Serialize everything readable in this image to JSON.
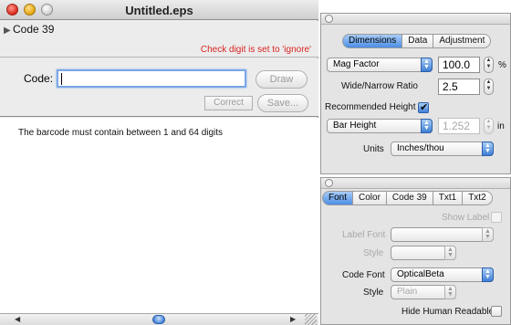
{
  "window": {
    "title": "Untitled.eps",
    "section_title": "Code 39",
    "check_note": "Check digit is set to 'ignore'",
    "code_label": "Code:",
    "code_value": "",
    "draw_label": "Draw",
    "correct_label": "Correct",
    "save_label": "Save...",
    "message": "The barcode must contain between 1 and 64  digits"
  },
  "dimensions_panel": {
    "tabs": [
      {
        "label": "Dimensions",
        "active": true
      },
      {
        "label": "Data",
        "active": false
      },
      {
        "label": "Adjustment",
        "active": false
      }
    ],
    "mag_factor_select": "Mag Factor",
    "mag_factor_value": "100.0",
    "mag_factor_unit": "%",
    "ratio_label": "Wide/Narrow Ratio",
    "ratio_value": "2.5",
    "recommended_height_label": "Recommended Height",
    "recommended_height_checked": true,
    "bar_height_select": "Bar Height",
    "bar_height_value": "1.252",
    "bar_height_unit": "in",
    "units_label": "Units",
    "units_value": "Inches/thou"
  },
  "font_panel": {
    "tabs": [
      {
        "label": "Font",
        "active": true
      },
      {
        "label": "Color",
        "active": false
      },
      {
        "label": "Code 39",
        "active": false
      },
      {
        "label": "Txt1",
        "active": false
      },
      {
        "label": "Txt2",
        "active": false
      }
    ],
    "show_label": "Show Label",
    "label_font_label": "Label Font",
    "style_label": "Style",
    "code_font_label": "Code Font",
    "code_font_value": "OpticalBeta",
    "code_style_label": "Style",
    "code_style_value": "Plain",
    "hide_human_readable_label": "Hide Human Readable"
  },
  "colors": {
    "accent": "#4c8ee6",
    "warning": "#d8231f"
  }
}
